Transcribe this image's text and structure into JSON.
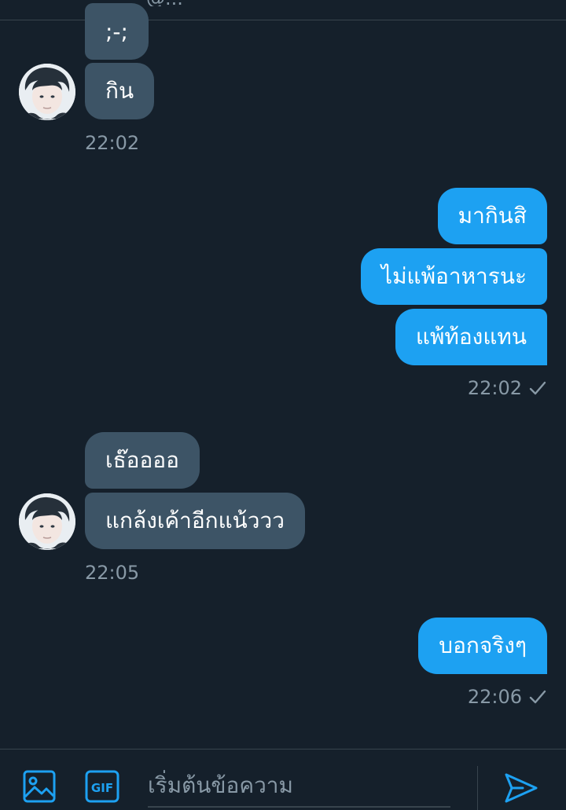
{
  "header": {
    "handle_partial": "@..._"
  },
  "messages": [
    {
      "id": "m1",
      "direction": "received",
      "text": ";-;"
    },
    {
      "id": "m2",
      "direction": "received",
      "text": "กิน"
    },
    {
      "id": "t1",
      "type": "timestamp",
      "direction": "received",
      "text": "22:02"
    },
    {
      "id": "m3",
      "direction": "sent",
      "text": "มากินสิ"
    },
    {
      "id": "m4",
      "direction": "sent",
      "text": "ไม่แพ้อาหารนะ"
    },
    {
      "id": "m5",
      "direction": "sent",
      "text": "แพ้ท้องแทน"
    },
    {
      "id": "t2",
      "type": "timestamp",
      "direction": "sent",
      "text": "22:02",
      "status": "sent-check"
    },
    {
      "id": "m6",
      "direction": "received",
      "text": "เธ๊ออออ"
    },
    {
      "id": "m7",
      "direction": "received",
      "text": "แกล้งเค้าอีกแน้ววว"
    },
    {
      "id": "t3",
      "type": "timestamp",
      "direction": "received",
      "text": "22:05"
    },
    {
      "id": "m8",
      "direction": "sent",
      "text": "บอกจริงๆ"
    },
    {
      "id": "t4",
      "type": "timestamp",
      "direction": "sent",
      "text": "22:06",
      "status": "sent-check"
    }
  ],
  "composer": {
    "placeholder": "เริ่มต้นข้อความ",
    "icons": [
      "image-icon",
      "gif-icon",
      "send-icon"
    ],
    "gif_label": "GIF"
  },
  "colors": {
    "background": "#15202b",
    "received_bubble": "#3d5466",
    "sent_bubble": "#1da1f2",
    "muted_text": "#8899a6",
    "accent": "#1da1f2"
  }
}
